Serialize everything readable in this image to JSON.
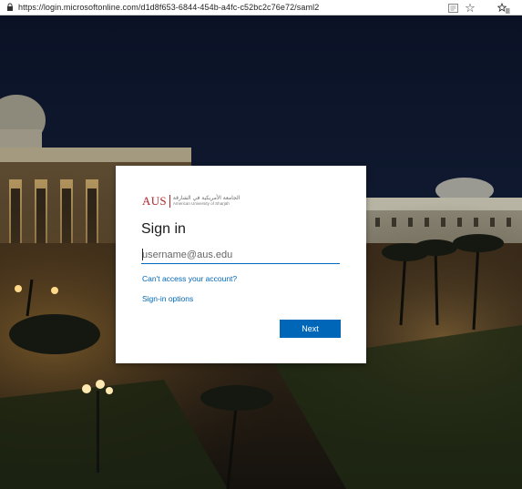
{
  "browser": {
    "url": "https://login.microsoftonline.com/d1d8f653-6844-454b-a4fc-c52bc2c76e72/saml2"
  },
  "logo": {
    "text": "AUS",
    "arabic": "الجامعة الأمريكية في الشارقة",
    "subtitle": "American University of Sharjah"
  },
  "signin": {
    "title": "Sign in",
    "username_placeholder": "username@aus.edu",
    "username_value": "",
    "cant_access_link": "Can't access your account?",
    "signin_options_link": "Sign-in options",
    "next_button": "Next"
  },
  "colors": {
    "accent": "#0067b8",
    "brand": "#b0272d",
    "card_bg": "#ffffff",
    "night_sky": "#0b1222"
  },
  "icons": {
    "lock": "lock-icon",
    "reader": "reader-view-icon",
    "star": "star-icon",
    "favorites": "favorites-icon"
  }
}
